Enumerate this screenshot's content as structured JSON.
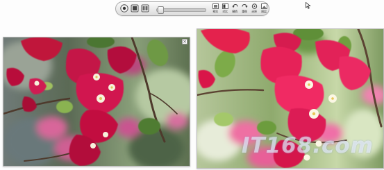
{
  "toolbar": {
    "view_buttons": [
      "eye-icon",
      "single-view-icon",
      "split-view-icon"
    ],
    "zoom_level": 0.05,
    "tools": [
      {
        "label": "预览",
        "icon": "preview-icon"
      },
      {
        "label": "对比",
        "icon": "compare-icon"
      },
      {
        "label": "撤销",
        "icon": "undo-icon"
      },
      {
        "label": "重做",
        "icon": "redo-icon"
      },
      {
        "label": "还原",
        "icon": "restore-icon"
      },
      {
        "label": "图层",
        "icon": "layers-icon"
      }
    ]
  },
  "panels": {
    "left": {
      "close_label": "×"
    },
    "right": {
      "watermark": "IT168.com"
    }
  }
}
